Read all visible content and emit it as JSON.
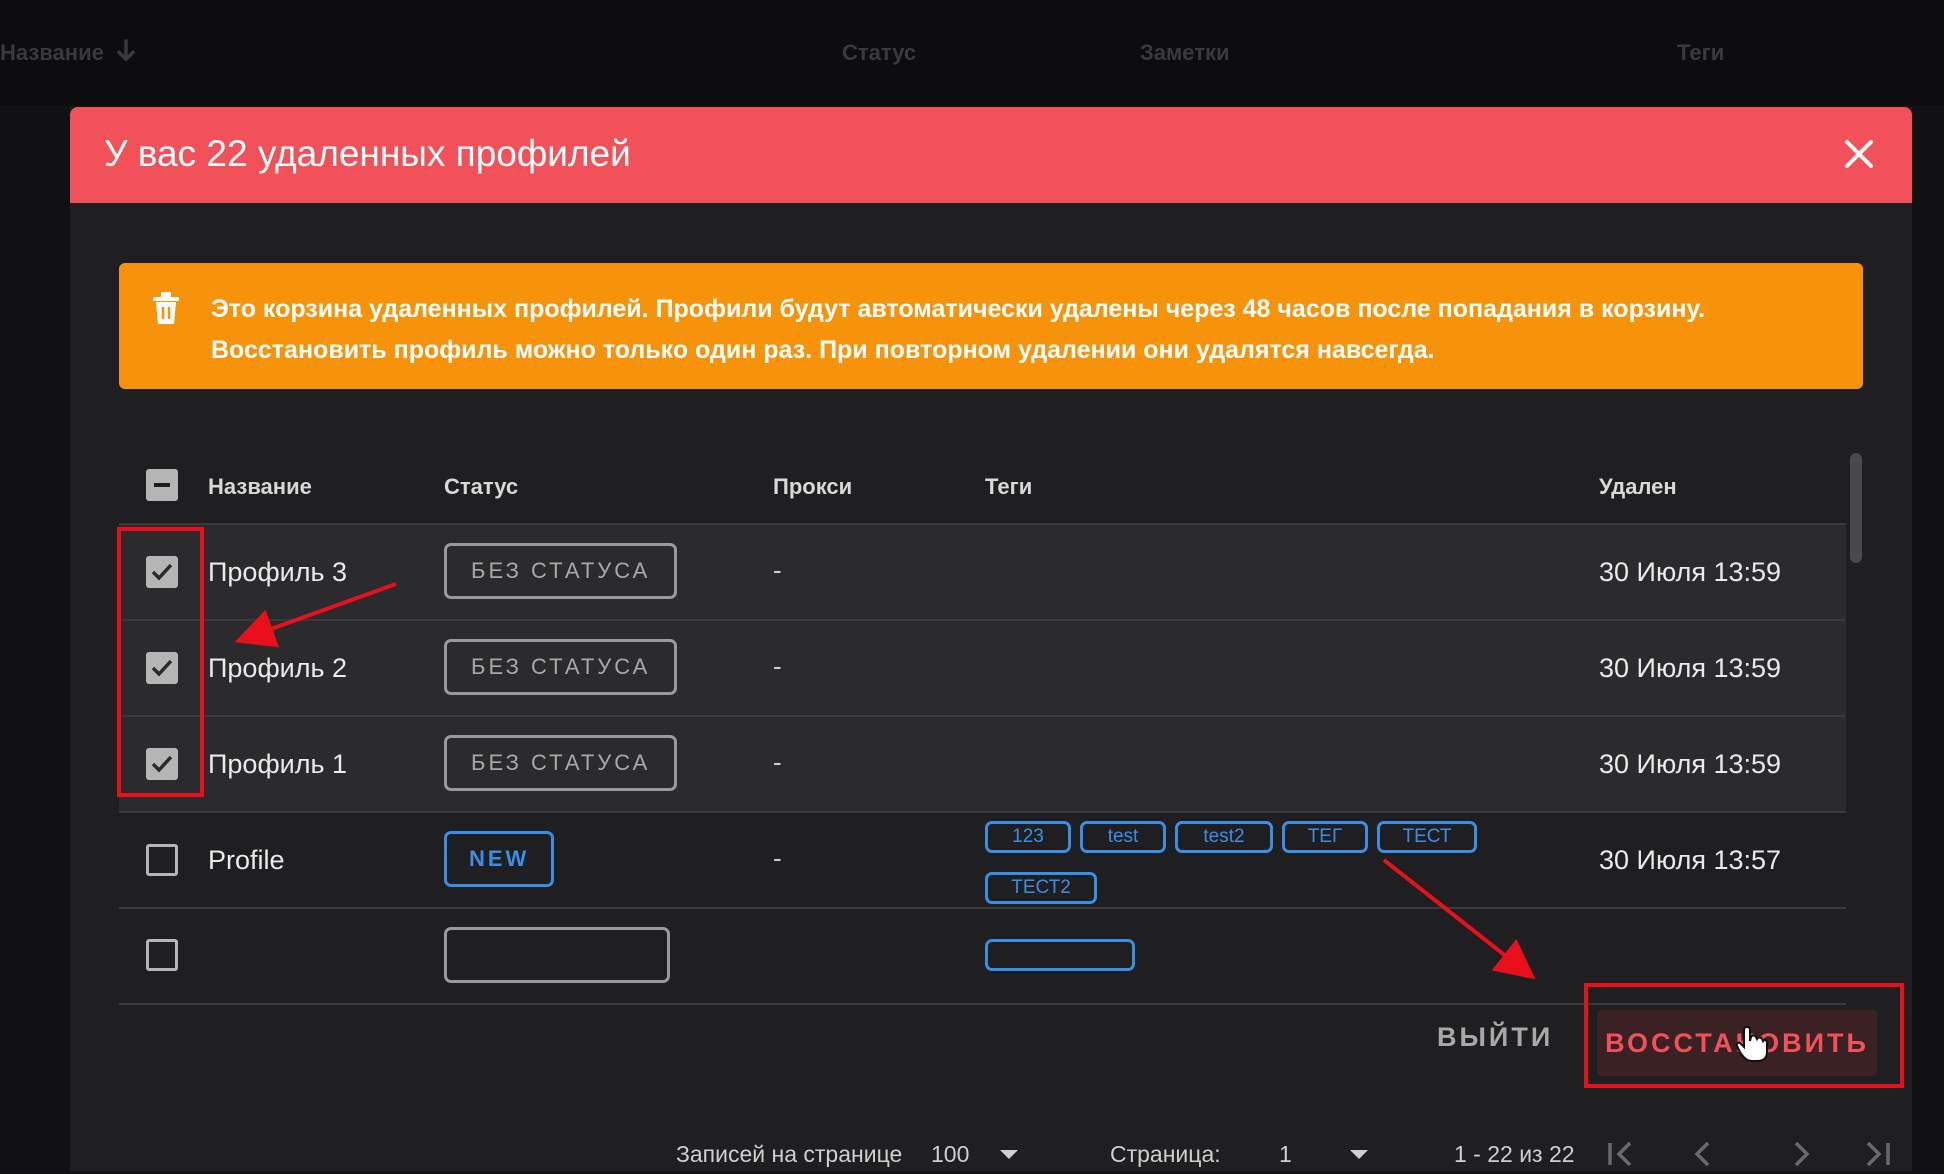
{
  "background": {
    "columns": [
      "Название",
      "Статус",
      "Заметки",
      "Теги"
    ]
  },
  "dialog": {
    "title": "У вас 22 удаленных профилей",
    "alert": {
      "line1": "Это корзина удаленных профилей. Профили будут автоматически удалены через 48 часов после попадания в корзину.",
      "line2": "Восстановить профиль можно только один раз. При повторном удалении они удалятся навсегда."
    },
    "table": {
      "headers": {
        "name": "Название",
        "status": "Статус",
        "proxy": "Прокси",
        "tags": "Теги",
        "deleted": "Удален"
      },
      "rows": [
        {
          "name": "Профиль 3",
          "status": "БЕЗ СТАТУСА",
          "proxy": "-",
          "tags": [],
          "deleted": "30 Июля 13:59",
          "checked": true
        },
        {
          "name": "Профиль 2",
          "status": "БЕЗ СТАТУСА",
          "proxy": "-",
          "tags": [],
          "deleted": "30 Июля 13:59",
          "checked": true
        },
        {
          "name": "Профиль 1",
          "status": "БЕЗ СТАТУСА",
          "proxy": "-",
          "tags": [],
          "deleted": "30 Июля 13:59",
          "checked": true
        },
        {
          "name": "Profile",
          "status": "NEW",
          "proxy": "-",
          "tags": [
            "123",
            "test",
            "test2",
            "ТЕГ",
            "ТЕСТ",
            "ТЕСТ2"
          ],
          "deleted": "30 Июля 13:57",
          "checked": false
        }
      ]
    },
    "actions": {
      "exit": "ВЫЙТИ",
      "restore": "ВОССТАНОВИТЬ"
    },
    "pagination": {
      "per_page_label": "Записей на странице",
      "per_page_value": "100",
      "page_label": "Страница:",
      "page_value": "1",
      "range": "1 - 22 из 22"
    }
  },
  "colors": {
    "header_red": "#f25159",
    "alert_orange": "#f7930a",
    "tag_blue": "#3b8ee6",
    "annotation_red": "#e8101a"
  },
  "icons": [
    "sort-down-icon",
    "close-icon",
    "trash-icon",
    "checkbox-indeterminate-icon",
    "checkmark-icon",
    "dropdown-caret-icon",
    "first-page-icon",
    "prev-page-icon",
    "next-page-icon",
    "last-page-icon",
    "hand-cursor-icon"
  ]
}
